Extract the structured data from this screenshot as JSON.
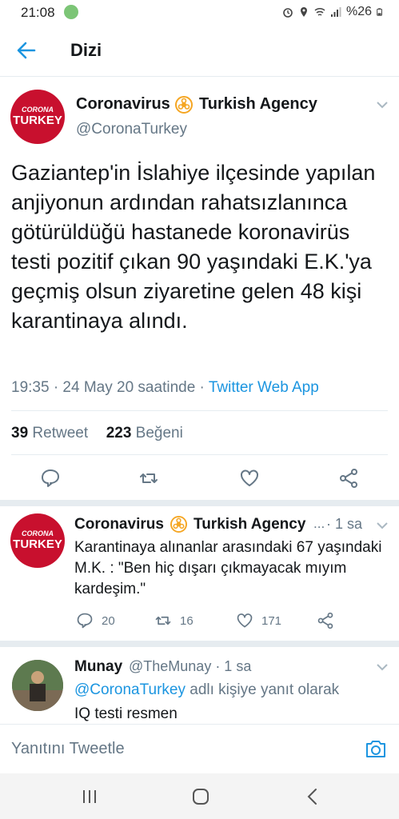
{
  "status_bar": {
    "time": "21:08",
    "battery": "%26"
  },
  "app_bar": {
    "title": "Dizi"
  },
  "main_tweet": {
    "avatar_line1": "CORONA",
    "avatar_line2": "TURKEY",
    "name_part1": "Coronavirus",
    "name_part2": "Turkish Agency",
    "handle": "@CoronaTurkey",
    "text": "Gaziantep'in İslahiye ilçesinde yapılan anjiyonun ardından rahatsızlanınca götürüldüğü hastanede koronavirüs testi pozitif çıkan 90 yaşındaki E.K.'ya geçmiş olsun ziyaretine gelen 48 kişi karantinaya alındı.",
    "timestamp": "19:35 · 24 May 20 saatinde · ",
    "source": "Twitter Web App",
    "retweet_count": "39",
    "retweet_label": "Retweet",
    "like_count": "223",
    "like_label": "Beğeni"
  },
  "reply1": {
    "avatar_line1": "CORONA",
    "avatar_line2": "TURKEY",
    "name_part1": "Coronavirus",
    "name_part2": "Turkish Agency",
    "ellipsis": "...",
    "time": "· 1 sa",
    "text": "Karantinaya alınanlar arasındaki 67 yaşındaki M.K. : \"Ben hiç dışarı çıkmayacak mıyım kardeşim.\"",
    "reply_count": "20",
    "retweet_count": "16",
    "like_count": "171"
  },
  "reply2": {
    "name": "Munay",
    "handle_time": "@TheMunay · 1 sa",
    "mention": "@CoronaTurkey",
    "reply_to_suffix": " adlı kişiye yanıt olarak",
    "text": "IQ testi resmen"
  },
  "composer": {
    "placeholder": "Yanıtını Tweetle"
  },
  "colors": {
    "accent": "#1b95e0",
    "avatar_red": "#c8102e",
    "badge_orange": "#f5a623"
  }
}
